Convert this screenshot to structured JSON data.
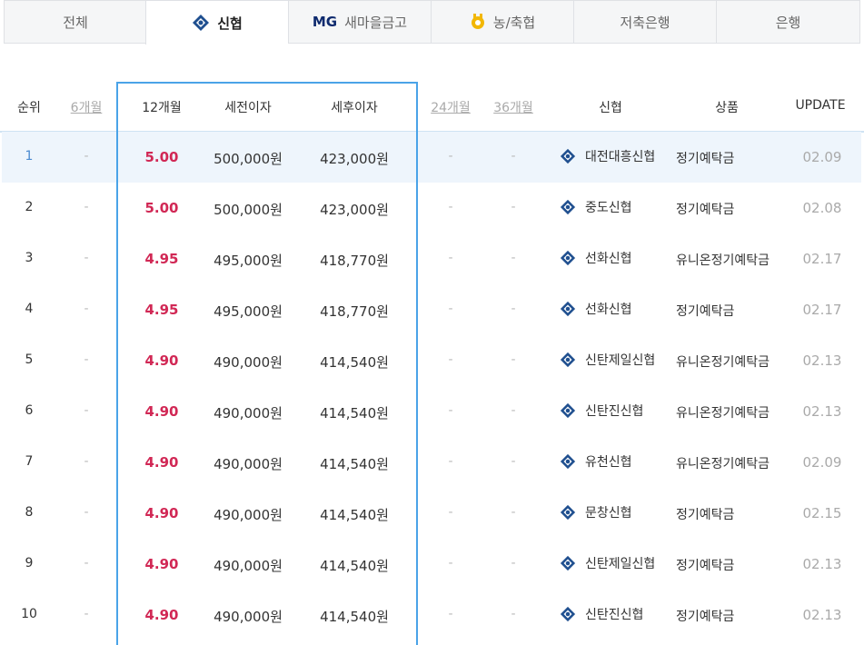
{
  "tabs": [
    {
      "label": "전체",
      "icon": null,
      "active": false
    },
    {
      "label": "신협",
      "icon": "shinhyup-logo-icon",
      "active": true
    },
    {
      "label": "새마을금고",
      "icon": "mg-logo-icon",
      "prefix": "MG",
      "active": false
    },
    {
      "label": "농/축협",
      "icon": "nonghyup-logo-icon",
      "active": false
    },
    {
      "label": "저축은행",
      "icon": null,
      "active": false
    },
    {
      "label": "은행",
      "icon": null,
      "active": false
    }
  ],
  "columns": {
    "rank": "순위",
    "m6": "6개월",
    "m12": "12개월",
    "pretax": "세전이자",
    "posttax": "세후이자",
    "m24": "24개월",
    "m36": "36개월",
    "bank": "신협",
    "product": "상품",
    "update": "UPDATE"
  },
  "rows": [
    {
      "rank": "1",
      "m6": "-",
      "m12": "5.00",
      "pretax": "500,000원",
      "posttax": "423,000원",
      "m24": "-",
      "m36": "-",
      "bank": "대전대흥신협",
      "product": "정기예탁금",
      "update": "02.09"
    },
    {
      "rank": "2",
      "m6": "-",
      "m12": "5.00",
      "pretax": "500,000원",
      "posttax": "423,000원",
      "m24": "-",
      "m36": "-",
      "bank": "중도신협",
      "product": "정기예탁금",
      "update": "02.08"
    },
    {
      "rank": "3",
      "m6": "-",
      "m12": "4.95",
      "pretax": "495,000원",
      "posttax": "418,770원",
      "m24": "-",
      "m36": "-",
      "bank": "선화신협",
      "product": "유니온정기예탁금",
      "update": "02.17"
    },
    {
      "rank": "4",
      "m6": "-",
      "m12": "4.95",
      "pretax": "495,000원",
      "posttax": "418,770원",
      "m24": "-",
      "m36": "-",
      "bank": "선화신협",
      "product": "정기예탁금",
      "update": "02.17"
    },
    {
      "rank": "5",
      "m6": "-",
      "m12": "4.90",
      "pretax": "490,000원",
      "posttax": "414,540원",
      "m24": "-",
      "m36": "-",
      "bank": "신탄제일신협",
      "product": "유니온정기예탁금",
      "update": "02.13"
    },
    {
      "rank": "6",
      "m6": "-",
      "m12": "4.90",
      "pretax": "490,000원",
      "posttax": "414,540원",
      "m24": "-",
      "m36": "-",
      "bank": "신탄진신협",
      "product": "유니온정기예탁금",
      "update": "02.13"
    },
    {
      "rank": "7",
      "m6": "-",
      "m12": "4.90",
      "pretax": "490,000원",
      "posttax": "414,540원",
      "m24": "-",
      "m36": "-",
      "bank": "유천신협",
      "product": "유니온정기예탁금",
      "update": "02.09"
    },
    {
      "rank": "8",
      "m6": "-",
      "m12": "4.90",
      "pretax": "490,000원",
      "posttax": "414,540원",
      "m24": "-",
      "m36": "-",
      "bank": "문창신협",
      "product": "정기예탁금",
      "update": "02.15"
    },
    {
      "rank": "9",
      "m6": "-",
      "m12": "4.90",
      "pretax": "490,000원",
      "posttax": "414,540원",
      "m24": "-",
      "m36": "-",
      "bank": "신탄제일신협",
      "product": "정기예탁금",
      "update": "02.13"
    },
    {
      "rank": "10",
      "m6": "-",
      "m12": "4.90",
      "pretax": "490,000원",
      "posttax": "414,540원",
      "m24": "-",
      "m36": "-",
      "bank": "신탄진신협",
      "product": "정기예탁금",
      "update": "02.13"
    }
  ],
  "colors": {
    "rate": "#d12855",
    "highlight_border": "#4aa3e8",
    "selected_row_bg": "#eef5fc",
    "shinhyup_logo": "#1f4f8f"
  }
}
